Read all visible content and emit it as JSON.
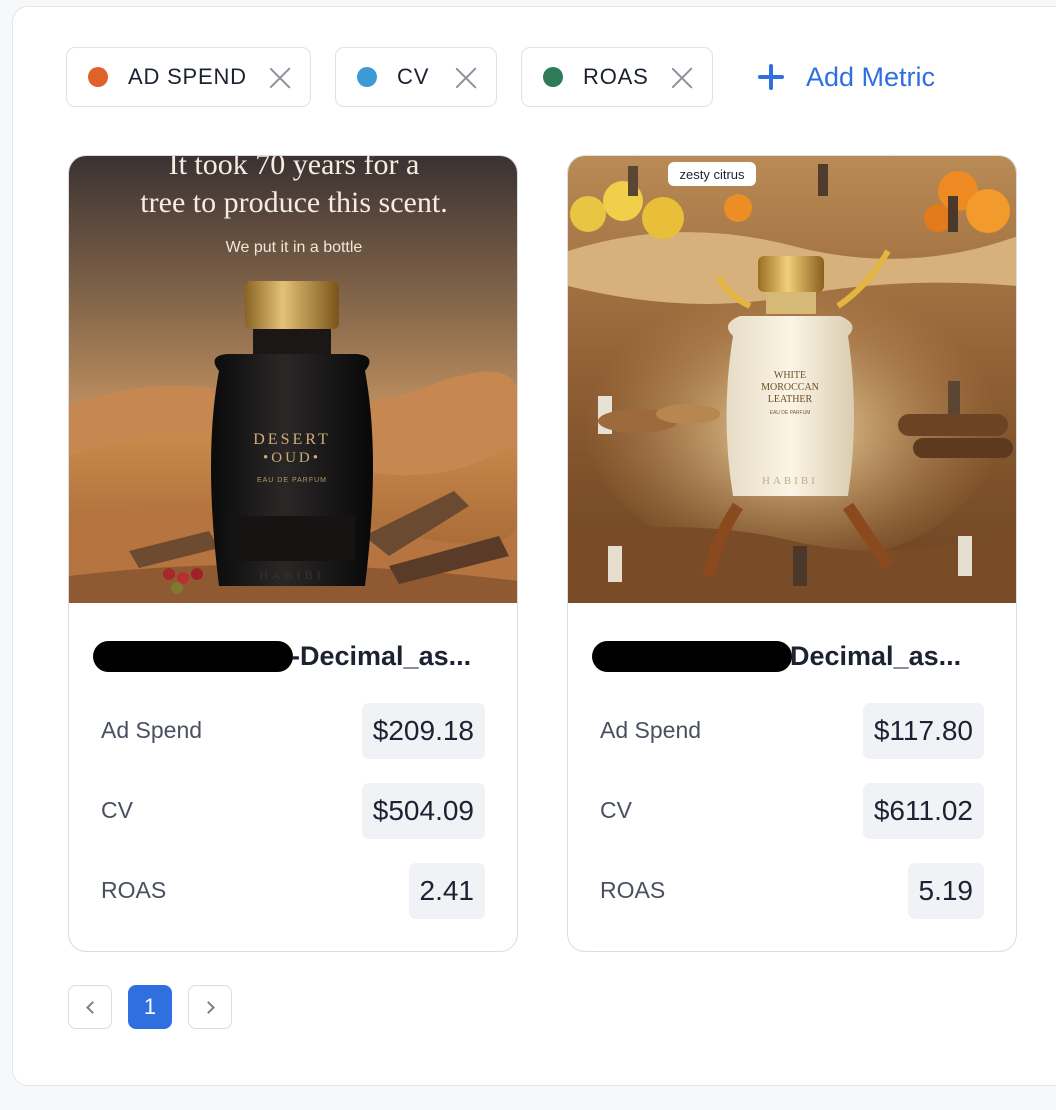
{
  "metric_chips": [
    {
      "label": "AD SPEND",
      "color": "#e0622b"
    },
    {
      "label": "CV",
      "color": "#3e9ad6"
    },
    {
      "label": "ROAS",
      "color": "#2f7a57"
    }
  ],
  "add_metric_label": "Add Metric",
  "cards": [
    {
      "title_suffix": "-Decimal_as...",
      "image": {
        "headline_line1": "It took 70 years for a",
        "headline_line2": "tree to produce this scent.",
        "subline": "We put it in a bottle",
        "bottle_name_line1": "DESERT",
        "bottle_name_line2": "•OUD•",
        "bottle_sub": "EAU DE PARFUM",
        "brand": "HABIBI"
      },
      "metrics": [
        {
          "label": "Ad Spend",
          "value": "$209.18"
        },
        {
          "label": "CV",
          "value": "$504.09"
        },
        {
          "label": "ROAS",
          "value": "2.41"
        }
      ]
    },
    {
      "title_suffix": "Decimal_as...",
      "image": {
        "tag": "zesty citrus",
        "bottle_name_line1": "WHITE",
        "bottle_name_line2": "MOROCCAN",
        "bottle_name_line3": "LEATHER",
        "bottle_sub": "EAU DE PARFUM",
        "brand": "HABIBI"
      },
      "metrics": [
        {
          "label": "Ad Spend",
          "value": "$117.80"
        },
        {
          "label": "CV",
          "value": "$611.02"
        },
        {
          "label": "ROAS",
          "value": "5.19"
        }
      ]
    }
  ],
  "pagination": {
    "current_page": "1"
  }
}
